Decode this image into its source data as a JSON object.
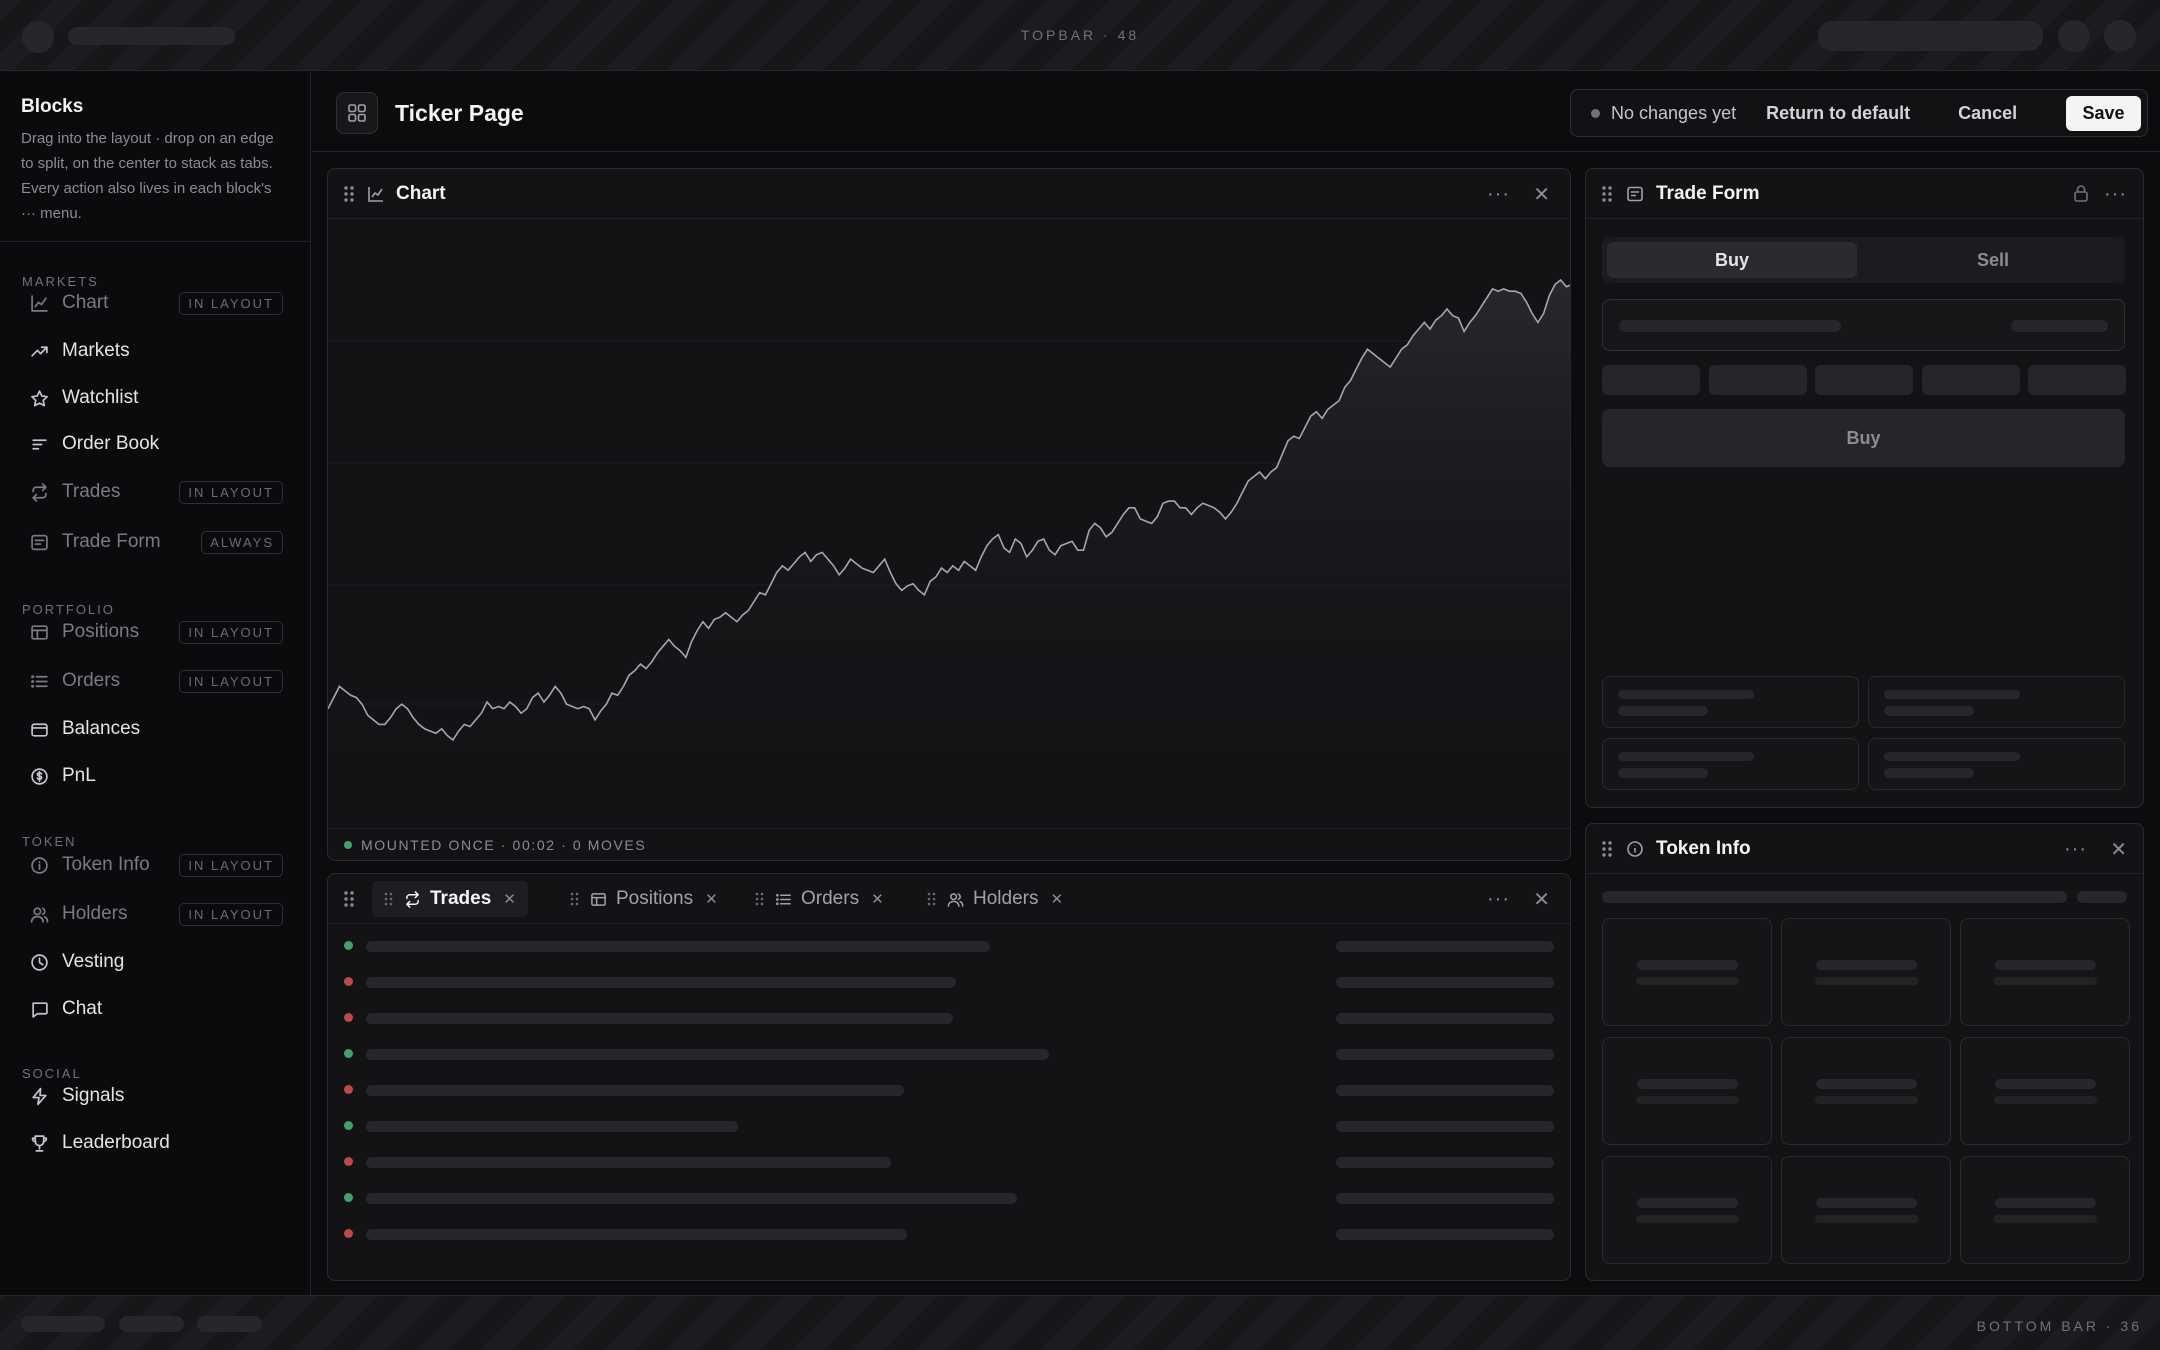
{
  "topbar": {
    "label": "TOPBAR · 48"
  },
  "bottombar": {
    "label": "BOTTOM BAR · 36"
  },
  "sidebar": {
    "title": "Blocks",
    "description": "Drag into the layout · drop on an edge to split, on the center to stack as tabs. Every action also lives in each block's ··· menu.",
    "sections": {
      "markets": "MARKETS",
      "portfolio": "PORTFOLIO",
      "token": "TOKEN",
      "social": "SOCIAL"
    },
    "items": [
      {
        "label": "Chart",
        "icon": "chart-line-icon",
        "badge": "IN LAYOUT"
      },
      {
        "label": "Markets",
        "icon": "trending-up-icon",
        "badge": ""
      },
      {
        "label": "Watchlist",
        "icon": "star-icon",
        "badge": ""
      },
      {
        "label": "Order Book",
        "icon": "order-book-icon",
        "badge": ""
      },
      {
        "label": "Trades",
        "icon": "repeat-icon",
        "badge": "IN LAYOUT"
      },
      {
        "label": "Trade Form",
        "icon": "form-icon",
        "badge": "ALWAYS"
      },
      {
        "label": "Positions",
        "icon": "table-icon",
        "badge": "IN LAYOUT"
      },
      {
        "label": "Orders",
        "icon": "list-icon",
        "badge": "IN LAYOUT"
      },
      {
        "label": "Balances",
        "icon": "wallet-icon",
        "badge": ""
      },
      {
        "label": "PnL",
        "icon": "dollar-circle-icon",
        "badge": ""
      },
      {
        "label": "Token Info",
        "icon": "info-icon",
        "badge": "IN LAYOUT"
      },
      {
        "label": "Holders",
        "icon": "users-icon",
        "badge": "IN LAYOUT"
      },
      {
        "label": "Vesting",
        "icon": "clock-icon",
        "badge": ""
      },
      {
        "label": "Chat",
        "icon": "chat-icon",
        "badge": ""
      },
      {
        "label": "Signals",
        "icon": "bolt-icon",
        "badge": ""
      },
      {
        "label": "Leaderboard",
        "icon": "trophy-icon",
        "badge": ""
      }
    ]
  },
  "header": {
    "title": "Ticker Page",
    "status": "No changes yet",
    "return_label": "Return to default",
    "cancel_label": "Cancel",
    "save_label": "Save"
  },
  "chart_panel": {
    "title": "Chart",
    "footer": "MOUNTED ONCE · 00:02 · 0 MOVES"
  },
  "trade_form": {
    "title": "Trade Form",
    "buy_tab": "Buy",
    "sell_tab": "Sell",
    "submit_label": "Buy"
  },
  "token_info": {
    "title": "Token Info"
  },
  "bottom_panel": {
    "tabs": [
      {
        "label": "Trades",
        "icon": "repeat-icon",
        "active": true
      },
      {
        "label": "Positions",
        "icon": "table-icon",
        "active": false
      },
      {
        "label": "Orders",
        "icon": "list-icon",
        "active": false
      },
      {
        "label": "Holders",
        "icon": "users-icon",
        "active": false
      }
    ],
    "rows": [
      "buy",
      "sell",
      "sell",
      "buy",
      "sell",
      "buy",
      "sell",
      "buy",
      "sell"
    ]
  },
  "colors": {
    "buy": "#3fa566",
    "sell": "#c04848",
    "accent": "#f4f4f5"
  },
  "chart_data": {
    "type": "line",
    "title": "",
    "xlabel": "",
    "ylabel": "",
    "series": [
      {
        "values": [
          55,
          60,
          65,
          63,
          61,
          60,
          57,
          52,
          50,
          48,
          48,
          51,
          55,
          57,
          55,
          51,
          48,
          46,
          45,
          44,
          46,
          43,
          41,
          45,
          48,
          47,
          50,
          53,
          58,
          55,
          56,
          55,
          58,
          56,
          53,
          55,
          60,
          62,
          58,
          61,
          65,
          62,
          57,
          56,
          55,
          56,
          55,
          50,
          54,
          57,
          62,
          61,
          65,
          70,
          72,
          75,
          73,
          76,
          80,
          83,
          86,
          83,
          81,
          78,
          85,
          90,
          94,
          91,
          95,
          96,
          98,
          96,
          94,
          97,
          99,
          103,
          107,
          106,
          111,
          116,
          119,
          117,
          120,
          123,
          125,
          121,
          124,
          125,
          122,
          119,
          115,
          118,
          122,
          120,
          118,
          117,
          116,
          119,
          122,
          116,
          111,
          108,
          110,
          111,
          108,
          106,
          112,
          114,
          118,
          116,
          119,
          117,
          121,
          119,
          117,
          123,
          128,
          131,
          133,
          127,
          125,
          131,
          129,
          123,
          126,
          130,
          131,
          126,
          124,
          128,
          129,
          130,
          126,
          126,
          135,
          138,
          136,
          132,
          134,
          138,
          142,
          145,
          145,
          140,
          139,
          138,
          141,
          147,
          148,
          148,
          145,
          145,
          142,
          145,
          147,
          146,
          145,
          143,
          140,
          143,
          147,
          152,
          157,
          159,
          161,
          158,
          161,
          163,
          169,
          175,
          177,
          176,
          181,
          186,
          188,
          185,
          189,
          191,
          193,
          199,
          202,
          207,
          212,
          216,
          214,
          212,
          210,
          208,
          212,
          216,
          218,
          222,
          225,
          228,
          225,
          229,
          231,
          234,
          231,
          230,
          224,
          228,
          231,
          235,
          239,
          243,
          242,
          243,
          242,
          242,
          241,
          237,
          232,
          228,
          232,
          240,
          245,
          247,
          244,
          245
        ]
      }
    ]
  }
}
